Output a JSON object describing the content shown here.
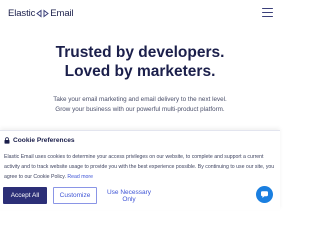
{
  "header": {
    "logo_left": "Elastic",
    "logo_right": "Email",
    "logo_mark_icon": "elastic-email-mark-icon",
    "menu_icon": "hamburger-menu-icon"
  },
  "hero": {
    "title_line1": "Trusted by developers.",
    "title_line2": "Loved by marketers.",
    "subtitle_line1": "Take your email marketing and email delivery to the next level.",
    "subtitle_line2": "Grow your business with our powerful multi-product platform."
  },
  "cookie": {
    "icon": "lock-icon",
    "title": "Cookie Preferences",
    "text": "Elastic Email uses cookies to determine your access privileges on our website, to complete and support a current activity and to track website usage to provide you with the best experience possible. By continuing to use our site, you agree to our Cookie Policy.",
    "read_more": "Read more",
    "accept_label": "Accept All",
    "customize_label": "Customize",
    "necessary_label": "Use Necessary Only"
  },
  "chat": {
    "icon": "chat-bubble-icon"
  },
  "colors": {
    "brand_navy": "#2c2f77",
    "link_blue": "#3f55d6",
    "chat_blue": "#1a7fe0",
    "heading": "#1b1f4b"
  }
}
